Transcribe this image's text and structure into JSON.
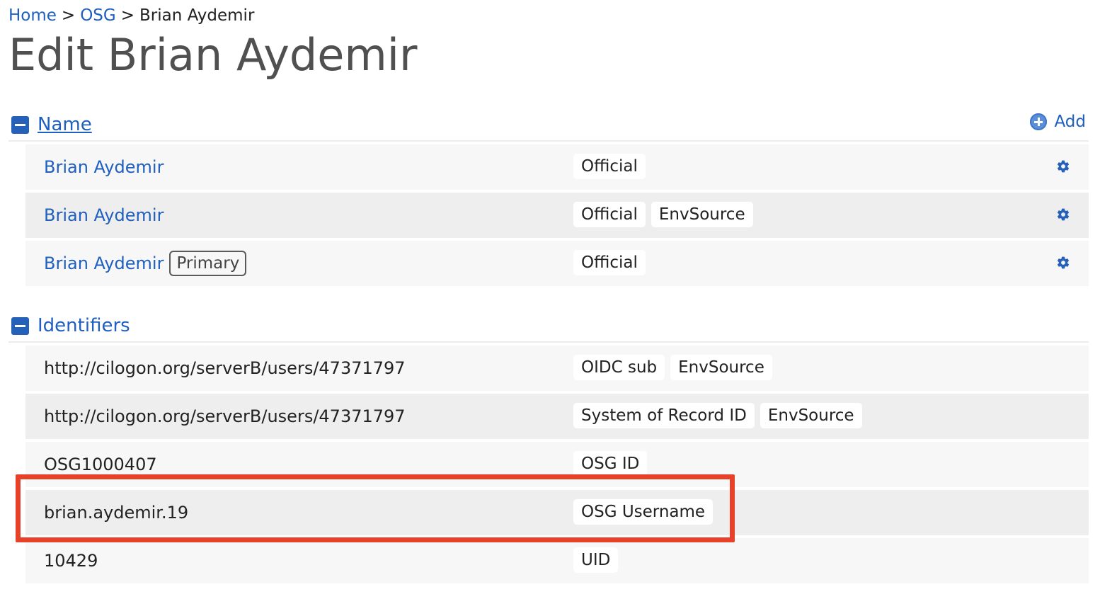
{
  "breadcrumb": {
    "home": "Home",
    "sep1": ">",
    "group": "OSG",
    "sep2": ">",
    "current": "Brian Aydemir"
  },
  "page_title": "Edit Brian Aydemir",
  "name_section": {
    "title": "Name",
    "add_label": "Add",
    "rows": [
      {
        "value": "Brian Aydemir",
        "badge": "",
        "tags": [
          "Official"
        ]
      },
      {
        "value": "Brian Aydemir",
        "badge": "",
        "tags": [
          "Official",
          "EnvSource"
        ]
      },
      {
        "value": "Brian Aydemir",
        "badge": "Primary",
        "tags": [
          "Official"
        ]
      }
    ]
  },
  "identifiers_section": {
    "title": "Identifiers",
    "rows": [
      {
        "value": "http://cilogon.org/serverB/users/47371797",
        "tags": [
          "OIDC sub",
          "EnvSource"
        ]
      },
      {
        "value": "http://cilogon.org/serverB/users/47371797",
        "tags": [
          "System of Record ID",
          "EnvSource"
        ]
      },
      {
        "value": "OSG1000407",
        "tags": [
          "OSG ID"
        ]
      },
      {
        "value": "brian.aydemir.19",
        "tags": [
          "OSG Username"
        ]
      },
      {
        "value": "10429",
        "tags": [
          "UID"
        ]
      }
    ]
  },
  "colors": {
    "link": "#1f5fbf",
    "accent": "#2561b8",
    "highlight": "#e8412a"
  },
  "icons": {
    "collapse": "minus-square-icon",
    "add": "plus-circle-icon",
    "settings": "gear-icon"
  }
}
